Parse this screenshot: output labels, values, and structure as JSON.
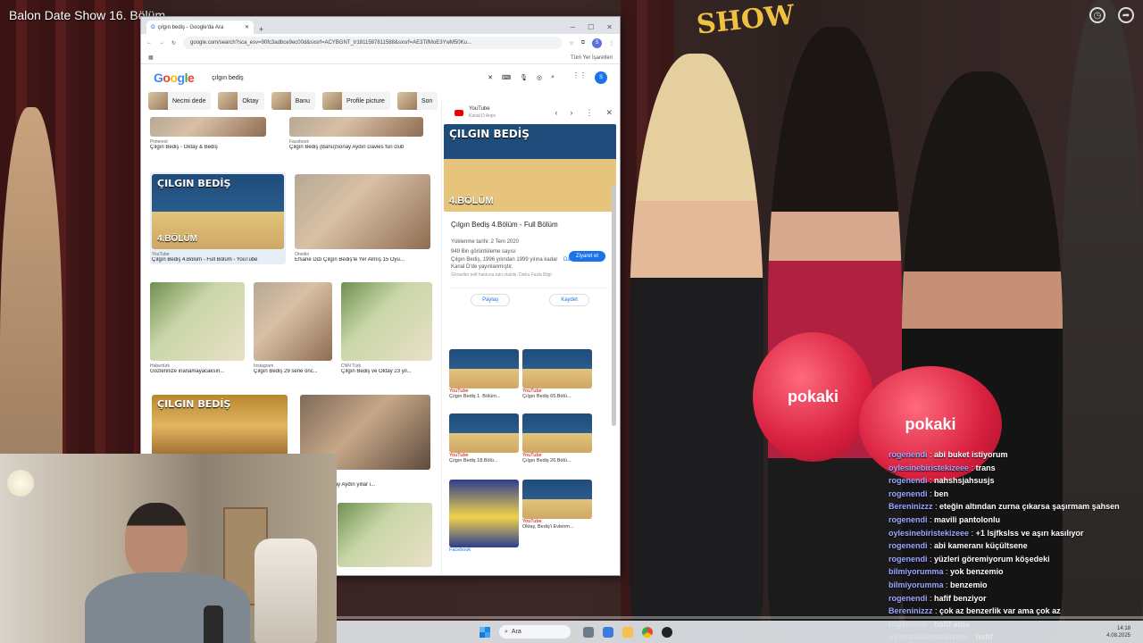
{
  "video": {
    "title": "Balon Date Show 16. Bölüm",
    "logo_text": "SHOW",
    "balloon_text": "pokaki",
    "progress": 0
  },
  "browser": {
    "tab_title": "çılgın bediş - Google'da Ara",
    "url": "google.com/search?sca_esv=90fc3adbce9ec00d&sxsrf=ACYBGNT_tr1811587811588&sxsrf=AE3TifMoE3YwM50Ku...",
    "all_bookmarks": "Tüm Yer İşaretleri",
    "search_query": "çılgın bediş",
    "avatar": "S",
    "chips": [
      "Necmi dede",
      "Oktay",
      "Banu",
      "Profile picture",
      "Son"
    ]
  },
  "results": [
    {
      "source": "Pinterest",
      "caption": "Çılgın Bediş - Oktay & Bediş"
    },
    {
      "source": "Facebook",
      "caption": "Çılgın Bediş (Banu)Sonay Aydın Davies fun club"
    },
    {
      "overlay": "ÇILGIN BEDİŞ",
      "episode": "4.BÖLÜM",
      "source": "YouTube",
      "caption": "Çılgın Bediş 4.Bölüm - Full Bölüm - YouTube"
    },
    {
      "source": "Onedio",
      "caption": "Efsane Dizi Çılgın Bediş'le Yer Almış 15 Oyu..."
    },
    {
      "source": "Habertürk",
      "caption": "Gözlerinize inanamayacaksın..."
    },
    {
      "source": "Instagram",
      "caption": "Çılgın Bediş 29 sene önc..."
    },
    {
      "source": "CNN Türk",
      "caption": "Çılgın Bediş ve Oktay 23 yıl..."
    },
    {
      "overlay": "ÇILGIN BEDİŞ",
      "source": "",
      "caption": ""
    },
    {
      "source": "",
      "caption": "...Banu'su Sonay Aydın yıllar i..."
    }
  ],
  "side_panel": {
    "source": "YouTube",
    "channel": "Kanal D Arşiv",
    "title": "Çılgın Bediş 4.Bölüm - Full Bölüm",
    "visit": "Ziyaret et",
    "uploaded": "Yüklenme tarihi: 2 Tem 2020",
    "views": "949 Bin görüntüleme sayısı",
    "desc": "Çılgın Bediş, 1996 yılından 1999 yılına kadar Kanal D'de yayınlanmıştır.",
    "more": "Daha fazla",
    "rights": "Görseller telif hakkına tabi olabilir. Daha Fazla Bilgi",
    "share": "Paylaş",
    "save": "Kaydet",
    "related": [
      {
        "source": "YouTube",
        "caption": "Çılgın Bediş 1. Bölüm..."
      },
      {
        "source": "YouTube",
        "caption": "Çılgın Bediş 65.Bölü..."
      },
      {
        "source": "YouTube",
        "caption": "Çılgın Bediş 18.Bölü..."
      },
      {
        "source": "YouTube",
        "caption": "Çılgın Bediş 26.Bölü..."
      },
      {
        "source": "Facebook",
        "caption": ""
      },
      {
        "source": "YouTube",
        "caption": "Oktay, Bediş'i Evlenm..."
      }
    ],
    "main_overlay": "ÇILGIN BEDİŞ",
    "main_episode": "4.BÖLÜM"
  },
  "chat": [
    {
      "user": "rogenendi",
      "msg": "abi buket istiyorum"
    },
    {
      "user": "oylesinebiristekizeee",
      "msg": "trans"
    },
    {
      "user": "rogenendi",
      "msg": "nahshsjahsusjs"
    },
    {
      "user": "rogenendi",
      "msg": "ben"
    },
    {
      "user": "Bereninizzz",
      "msg": "eteğin altından zurna çıkarsa şaşırmam şahsen"
    },
    {
      "user": "rogenendi",
      "msg": "mavili pantolonlu"
    },
    {
      "user": "oylesinebiristekizeee",
      "msg": "+1 lsjfkslss ve aşırı kasılıyor"
    },
    {
      "user": "rogenendi",
      "msg": "abi kameranı küçültsene"
    },
    {
      "user": "rogenendi",
      "msg": "yüzleri göremiyorum köşedeki"
    },
    {
      "user": "bilmiyorumma",
      "msg": "yok benzemio"
    },
    {
      "user": "bilmiyorumma",
      "msg": "benzemio"
    },
    {
      "user": "rogenendi",
      "msg": "hafif benziyor"
    },
    {
      "user": "Bereninizzz",
      "msg": "çok az benzerlik var ama çok az"
    },
    {
      "user": "rogenendi",
      "msg": "hafif ama"
    },
    {
      "user": "oylesinebiristekizeee",
      "msg": "hafif"
    }
  ],
  "taskbar": {
    "search": "Ara",
    "time": "14:18",
    "date": "4.08.2025"
  }
}
